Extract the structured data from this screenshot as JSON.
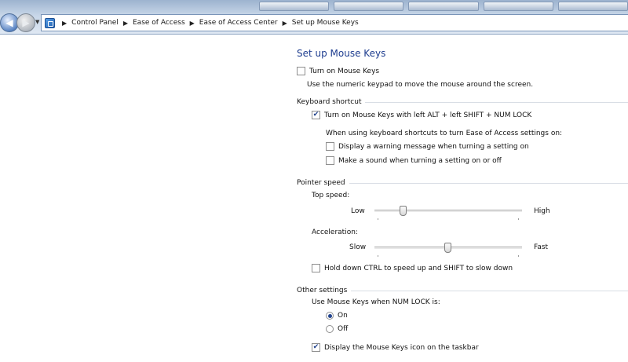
{
  "breadcrumb": [
    "Control Panel",
    "Ease of Access",
    "Ease of Access Center",
    "Set up Mouse Keys"
  ],
  "page_title": "Set up Mouse Keys",
  "turn_on": {
    "label": "Turn on Mouse Keys",
    "checked": false,
    "description": "Use the numeric keypad to move the mouse around the screen."
  },
  "keyboard_shortcut": {
    "heading": "Keyboard shortcut",
    "shortcut_label": "Turn on Mouse Keys with left ALT + left SHIFT + NUM LOCK",
    "shortcut_checked": true,
    "sub_text": "When using keyboard shortcuts to turn Ease of Access settings on:",
    "warning_label": "Display a warning message when turning a setting on",
    "warning_checked": false,
    "sound_label": "Make a sound when turning a setting on or off",
    "sound_checked": false
  },
  "pointer_speed": {
    "heading": "Pointer speed",
    "top_speed_label": "Top speed:",
    "top_low": "Low",
    "top_high": "High",
    "top_value": 0.18,
    "accel_label": "Acceleration:",
    "accel_slow": "Slow",
    "accel_fast": "Fast",
    "accel_value": 0.5,
    "ctrl_shift_label": "Hold down CTRL to speed up and SHIFT to slow down",
    "ctrl_shift_checked": false
  },
  "other": {
    "heading": "Other settings",
    "numlock_label": "Use Mouse Keys when NUM LOCK is:",
    "on_label": "On",
    "off_label": "Off",
    "selected": "On",
    "taskbar_label": "Display the Mouse Keys icon on the taskbar",
    "taskbar_checked": true
  },
  "colors": {
    "title": "#1e3d8f",
    "check": "#20418b"
  },
  "icons": {
    "back": "back-arrow-icon",
    "forward": "forward-arrow-icon",
    "control_panel": "control-panel-icon",
    "separator": "chevron-right-icon"
  }
}
